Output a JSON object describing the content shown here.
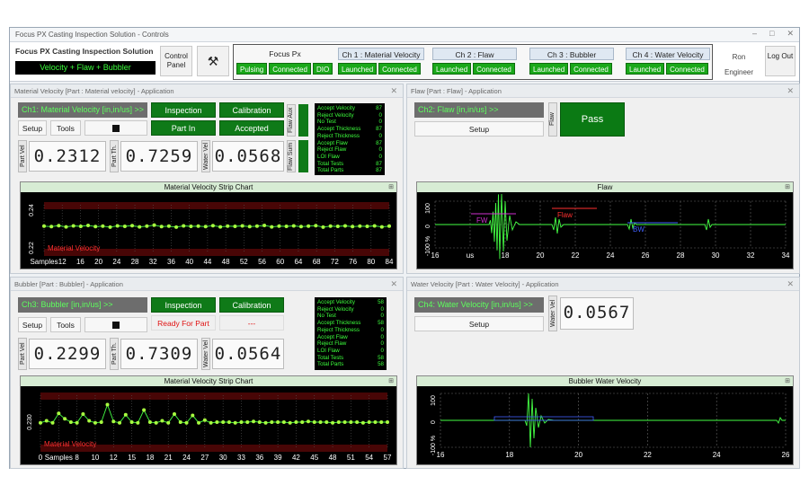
{
  "window": {
    "title": "Focus PX Casting Inspection Solution - Controls",
    "minimize": "–",
    "maximize": "□",
    "close": "✕"
  },
  "top": {
    "app_name": "Focus PX Casting Inspection Solution",
    "mode": "Velocity + Flaw + Bubbler",
    "control_panel": "Control Panel",
    "tools_icon": "wrench-hammer-icon",
    "focus": {
      "title": "Focus Px",
      "leds": [
        "Pulsing",
        "Connected",
        "DIO"
      ]
    },
    "channels": [
      {
        "title": "Ch 1 : Material Velocity",
        "leds": [
          "Launched",
          "Connected"
        ]
      },
      {
        "title": "Ch 2 : Flaw",
        "leds": [
          "Launched",
          "Connected"
        ]
      },
      {
        "title": "Ch 3 : Bubbler",
        "leds": [
          "Launched",
          "Connected"
        ]
      },
      {
        "title": "Ch 4 : Water Velocity",
        "leds": [
          "Launched",
          "Connected"
        ]
      }
    ],
    "user_name": "Ron",
    "user_role": "Engineer",
    "logout": "Log Out"
  },
  "mv": {
    "title": "Material Velocity [Part : Material velocity] - Application",
    "channel": "Ch1: Material Velocity [in,in/us] >>",
    "inspection": "Inspection",
    "calibration": "Calibration",
    "part_in": "Part In",
    "accepted": "Accepted",
    "setup": "Setup",
    "tools": "Tools",
    "aux_label": "Flaw Aux",
    "sum_label": "Flaw Sum",
    "part_vel_label": "Part Vel",
    "part_th_label": "Part Th.",
    "water_vel_label": "Water Vel",
    "part_vel": "0.2312",
    "part_th": "0.7259",
    "water_vel": "0.0568",
    "stats": [
      [
        "Accept Velocity",
        "87"
      ],
      [
        "Reject Velocity",
        "0"
      ],
      [
        "No Test",
        "0"
      ],
      [
        "Accept Thickness",
        "87"
      ],
      [
        "Reject Thickness",
        "0"
      ],
      [
        "Accept Flaw",
        "87"
      ],
      [
        "Reject Flaw",
        "0"
      ],
      [
        "LOI Flaw",
        "0"
      ],
      [
        "Total Tests",
        "87"
      ],
      [
        "Total Parts",
        "87"
      ]
    ]
  },
  "flaw": {
    "title": "Flaw [Part : Flaw] - Application",
    "channel": "Ch2: Flaw [in,in/us] >>",
    "setup": "Setup",
    "flaw_label": "Flaw",
    "pass": "Pass"
  },
  "bub": {
    "title": "Bubbler [Part : Bubbler] - Application",
    "channel": "Ch3: Bubbler [in,in/us] >>",
    "inspection": "Inspection",
    "calibration": "Calibration",
    "ready": "Ready For Part",
    "dashes": "---",
    "setup": "Setup",
    "tools": "Tools",
    "part_vel_label": "Part Vel",
    "part_th_label": "Part Th.",
    "water_vel_label": "Water Vel",
    "part_vel": "0.2299",
    "part_th": "0.7309",
    "water_vel": "0.0564",
    "stats": [
      [
        "Accept Velocity",
        "58"
      ],
      [
        "Reject Velocity",
        "0"
      ],
      [
        "No Test",
        "0"
      ],
      [
        "Accept Thickness",
        "58"
      ],
      [
        "Reject Thickness",
        "0"
      ],
      [
        "Accept Flaw",
        "0"
      ],
      [
        "Reject Flaw",
        "0"
      ],
      [
        "LOI Flaw",
        "0"
      ],
      [
        "Total Tests",
        "58"
      ],
      [
        "Total Parts",
        "58"
      ]
    ]
  },
  "wv": {
    "title": "Water Velocity [Part : Water Velocity] - Application",
    "channel": "Ch4: Water Velocity [in,in/us] >>",
    "setup": "Setup",
    "label": "Water Vel",
    "value": "0.0567"
  },
  "colors": {
    "led_green": "#1aa81a",
    "trace_green": "#44ff44",
    "limit_red": "#ff2020",
    "gate_blue": "#4060ff",
    "gate_magenta": "#d030d0"
  },
  "chart_data": [
    {
      "type": "line",
      "title": "Material Velocity Strip Chart",
      "series_label": "Material Velocity",
      "x_ticks": [
        "Samples",
        "12",
        "16",
        "20",
        "24",
        "28",
        "32",
        "36",
        "40",
        "44",
        "48",
        "52",
        "56",
        "60",
        "64",
        "68",
        "72",
        "76",
        "80",
        "84"
      ],
      "y_ticks": [
        "0.24",
        "0.22"
      ],
      "ylim": [
        0.22,
        0.24
      ],
      "values": [
        0.2312,
        0.231,
        0.2314,
        0.2309,
        0.2313,
        0.2311,
        0.2315,
        0.231,
        0.2312,
        0.2308,
        0.2313,
        0.2311,
        0.2314,
        0.2309,
        0.2312,
        0.2316,
        0.231,
        0.2312,
        0.2308,
        0.2313,
        0.2311,
        0.2312,
        0.231,
        0.2314,
        0.2309,
        0.2312,
        0.2311,
        0.2313,
        0.231,
        0.2312,
        0.2315,
        0.2309,
        0.2312,
        0.2311,
        0.2313,
        0.231,
        0.2312,
        0.2314,
        0.2308,
        0.2312,
        0.2311,
        0.2313,
        0.231,
        0.2312,
        0.2311,
        0.2313,
        0.2309,
        0.2312
      ]
    },
    {
      "type": "line",
      "title": "Flaw",
      "x_ticks": [
        "16",
        "us",
        "18",
        "20",
        "22",
        "24",
        "26",
        "28",
        "30",
        "32",
        "34"
      ],
      "y_ticks": [
        "100",
        "0",
        "-100 %"
      ],
      "gates": [
        "FW",
        "Flaw",
        "BW"
      ]
    },
    {
      "type": "line",
      "title": "Material Velocity Strip Chart",
      "series_label": "Material Velocity",
      "x_ticks": [
        "0",
        "Samples",
        "8",
        "10",
        "12",
        "15",
        "18",
        "21",
        "24",
        "27",
        "30",
        "33",
        "36",
        "39",
        "42",
        "45",
        "48",
        "51",
        "54",
        "57"
      ],
      "y_ticks": [
        "0.230"
      ],
      "ylim": [
        0.226,
        0.234
      ],
      "values": [
        0.2299,
        0.2302,
        0.2299,
        0.2313,
        0.2305,
        0.23,
        0.2299,
        0.2312,
        0.2302,
        0.2299,
        0.23,
        0.2326,
        0.2301,
        0.2299,
        0.2311,
        0.23,
        0.2299,
        0.2318,
        0.23,
        0.2299,
        0.2302,
        0.2299,
        0.2312,
        0.23,
        0.2299,
        0.231,
        0.2299,
        0.2303,
        0.2299,
        0.23,
        0.23,
        0.23,
        0.2299,
        0.23,
        0.23,
        0.2301,
        0.23,
        0.2299,
        0.23,
        0.23,
        0.23,
        0.2299,
        0.23,
        0.23,
        0.2301,
        0.23,
        0.23,
        0.23,
        0.2299,
        0.23,
        0.23,
        0.23,
        0.23,
        0.2299,
        0.23,
        0.23,
        0.23,
        0.23
      ]
    },
    {
      "type": "line",
      "title": "Bubbler Water Velocity",
      "x_ticks": [
        "16",
        "18",
        "20",
        "22",
        "24",
        "26"
      ],
      "y_ticks": [
        "100",
        "0",
        "-100 %"
      ]
    }
  ]
}
